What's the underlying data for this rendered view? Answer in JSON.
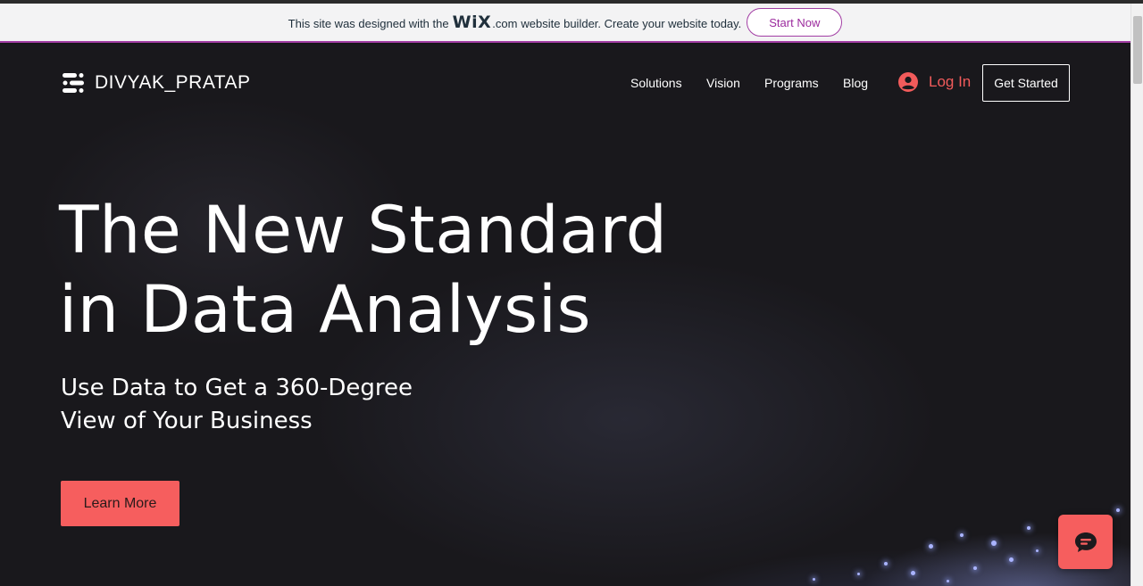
{
  "banner": {
    "text_before": "This site was designed with the",
    "wix_logo": "WiX",
    "wix_dotcom": ".com",
    "text_after": "website builder. Create your website today.",
    "cta_label": "Start Now",
    "accent_color": "#a23ea4"
  },
  "header": {
    "logo_icon": "stacked-bars-logo-icon",
    "brand": "DIVYAK_PRATAP",
    "nav": [
      {
        "label": "Solutions"
      },
      {
        "label": "Vision"
      },
      {
        "label": "Programs"
      },
      {
        "label": "Blog"
      }
    ],
    "login_icon": "user-avatar-icon",
    "login_label": "Log In",
    "get_started_label": "Get Started"
  },
  "hero": {
    "title_line1": "The New Standard",
    "title_line2": "in Data Analysis",
    "subtitle_line1": "Use Data to Get a 360-Degree",
    "subtitle_line2": "View of Your Business",
    "cta_label": "Learn More"
  },
  "chat": {
    "icon": "chat-bubble-icon"
  },
  "colors": {
    "accent": "#f65e5e",
    "background": "#19181c",
    "text": "#ffffff"
  }
}
